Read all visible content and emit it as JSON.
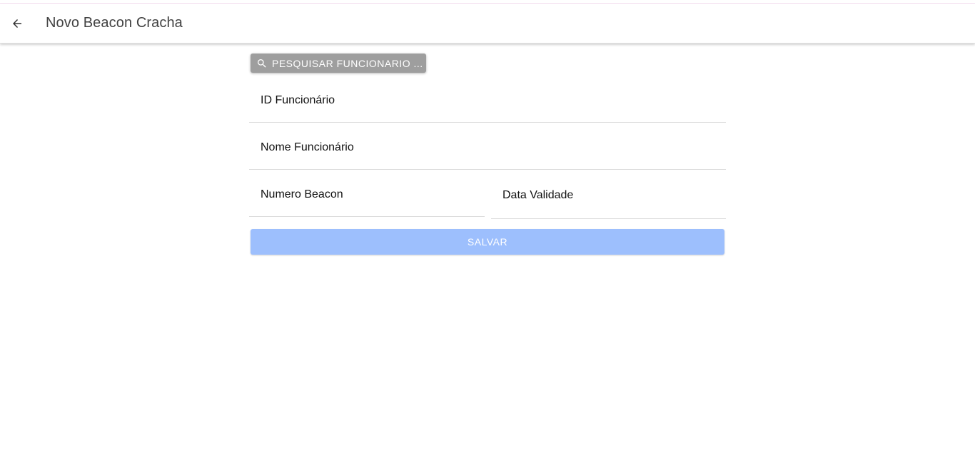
{
  "header": {
    "title": "Novo Beacon Cracha",
    "back_icon": "arrow-left-icon"
  },
  "search": {
    "label": "PESQUISAR FUNCIONARIO ...",
    "icon": "search-icon"
  },
  "form": {
    "employee_id": {
      "placeholder": "ID Funcionário",
      "value": ""
    },
    "employee_name": {
      "placeholder": "Nome Funcionário",
      "value": ""
    },
    "beacon_number": {
      "placeholder": "Numero Beacon",
      "value": ""
    },
    "expiry_date": {
      "placeholder": "Data Validade",
      "value": ""
    }
  },
  "actions": {
    "save_label": "SALVAR"
  },
  "colors": {
    "search_button": "#9e9e9e",
    "save_button": "#9dbffd",
    "title_text": "#424242"
  }
}
